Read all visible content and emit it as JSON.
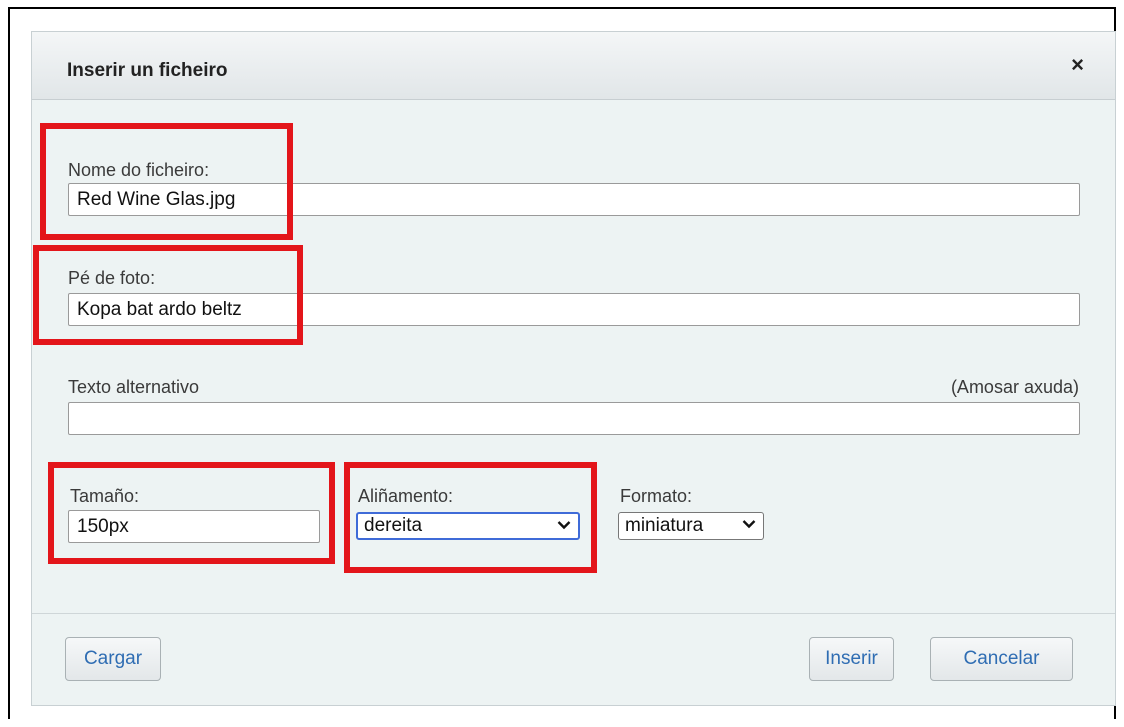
{
  "dialog": {
    "title": "Inserir un ficheiro",
    "close_symbol": "×"
  },
  "fields": {
    "filename": {
      "label": "Nome do ficheiro:",
      "value": "Red Wine Glas.jpg"
    },
    "caption": {
      "label": "Pé de foto:",
      "value": "Kopa bat ardo beltz"
    },
    "alt_text": {
      "label": "Texto alternativo",
      "value": "",
      "help_link": "(Amosar axuda)"
    },
    "size": {
      "label": "Tamaño:",
      "value": "150px"
    },
    "alignment": {
      "label": "Aliñamento:",
      "selected": "dereita"
    },
    "format": {
      "label": "Formato:",
      "selected": "miniatura"
    }
  },
  "buttons": {
    "upload": "Cargar",
    "insert": "Inserir",
    "cancel": "Cancelar"
  },
  "colors": {
    "highlight_box": "#e3151a",
    "focus_ring": "#3f6bd8",
    "button_text": "#2f6db3"
  }
}
